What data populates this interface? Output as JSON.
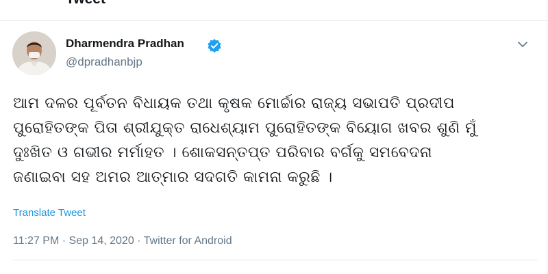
{
  "header": {
    "title": "Tweet"
  },
  "user": {
    "name": "Dharmendra Pradhan",
    "handle": "@dpradhanbjp"
  },
  "tweet": {
    "lines": [
      "ଆମ ଦଳର ପୂର୍ବତନ ବିଧାୟକ ତଥା କୃଷକ ମୋର୍ଚ୍ଚାର ରାଜ୍ୟ ସଭାପତି ପ୍ରଦୀପ",
      "ପୁରୋହିତଙ୍କ ପିତା ଶ୍ରୀଯୁକ୍ତ ରାଧେଶ୍ୟାମ ପୁରୋହିତଙ୍କ ବିୟୋଗ ଖବର ଶୁଣି ମୁଁ",
      "ଦୁଃଖିତ ଓ ଗଭୀର ମର୍ମାହତ । ଶୋକସନ୍ତପ୍ତ ପରିବାର ବର୍ଗକୁ ସମବେଦନା",
      "ଜଣାଇବା ସହ ଅମର ଆତ୍ମାର ସଦଗତି କାମନା କରୁଛି ।"
    ],
    "translate_label": "Translate Tweet",
    "meta": "11:27 PM · Sep 14, 2020 · Twitter for Android"
  },
  "icons": {
    "verified": "verified-badge-icon",
    "caret": "chevron-down-icon",
    "back": "back-arrow-icon"
  },
  "colors": {
    "verified": "#1da1f2",
    "link": "#1b95e0",
    "secondary": "#657786"
  }
}
